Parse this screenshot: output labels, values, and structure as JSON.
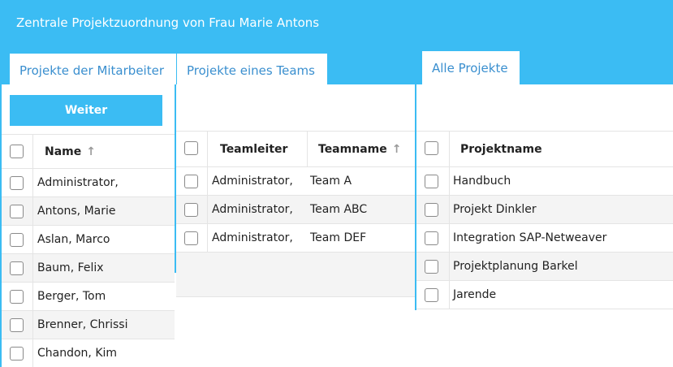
{
  "header": {
    "title": "Zentrale Projektzuordnung von Frau Marie Antons"
  },
  "tabs": [
    {
      "label": "Projekte der Mitarbeiter"
    },
    {
      "label": "Projekte eines Teams"
    },
    {
      "label": "Alle Projekte"
    }
  ],
  "employees": {
    "button_label": "Weiter",
    "header": {
      "name": "Name",
      "sort_icon": "↑"
    },
    "rows": [
      {
        "name": "Administrator,"
      },
      {
        "name": "Antons, Marie"
      },
      {
        "name": "Aslan, Marco"
      },
      {
        "name": "Baum, Felix"
      },
      {
        "name": "Berger, Tom"
      },
      {
        "name": "Brenner, Chrissi"
      },
      {
        "name": "Chandon, Kim"
      }
    ]
  },
  "teams": {
    "header": {
      "leader": "Teamleiter",
      "team": "Teamname",
      "sort_icon": "↑"
    },
    "rows": [
      {
        "leader": "Administrator,",
        "team": "Team A"
      },
      {
        "leader": "Administrator,",
        "team": "Team ABC"
      },
      {
        "leader": "Administrator,",
        "team": "Team DEF"
      }
    ]
  },
  "projects": {
    "header": {
      "name": "Projektname"
    },
    "rows": [
      {
        "name": "Handbuch"
      },
      {
        "name": "Projekt Dinkler"
      },
      {
        "name": "Integration SAP-Netweaver"
      },
      {
        "name": "Projektplanung Barkel"
      },
      {
        "name": "Jarende"
      }
    ]
  },
  "colors": {
    "accent": "#3bbcf3",
    "tab_text": "#3a8fcf",
    "row_alt": "#f4f4f4"
  }
}
